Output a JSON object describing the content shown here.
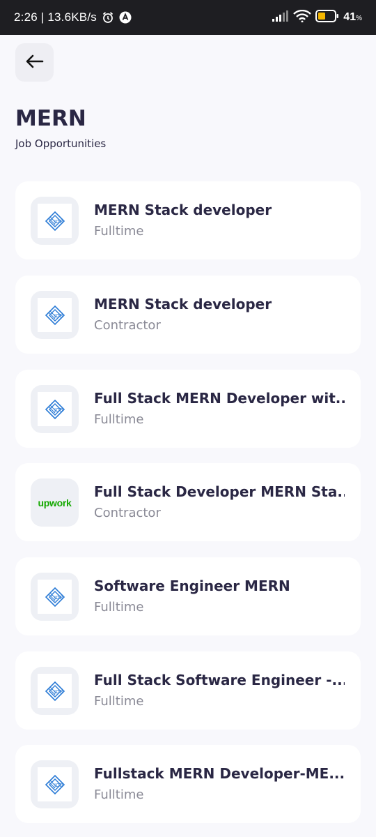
{
  "status_bar": {
    "time_speed": "2:26 | 13.6KB/s",
    "battery_percent": "41",
    "battery_unit": "%"
  },
  "header": {
    "back_icon": "arrow-left-icon",
    "title": "MERN",
    "subtitle": "Job Opportunities"
  },
  "jobs": [
    {
      "title": "MERN Stack developer",
      "type": "Fulltime",
      "logo": "job-logo"
    },
    {
      "title": "MERN Stack developer",
      "type": "Contractor",
      "logo": "job-logo"
    },
    {
      "title": "Full Stack MERN Developer wit...",
      "type": "Fulltime",
      "logo": "job-logo"
    },
    {
      "title": "Full Stack Developer MERN Sta...",
      "type": "Contractor",
      "logo": "upwork-logo",
      "logo_text": "upwork"
    },
    {
      "title": "Software Engineer MERN",
      "type": "Fulltime",
      "logo": "job-logo"
    },
    {
      "title": "Full Stack Software Engineer -...",
      "type": "Fulltime",
      "logo": "job-logo"
    },
    {
      "title": "Fullstack MERN Developer-ME...",
      "type": "Fulltime",
      "logo": "job-logo"
    }
  ],
  "colors": {
    "background": "#f8f8fc",
    "card": "#ffffff",
    "title_text": "#2a2744",
    "secondary_text": "#8a8a96",
    "upwork_green": "#14a800",
    "job_logo_blue": "#2b7bd6"
  }
}
